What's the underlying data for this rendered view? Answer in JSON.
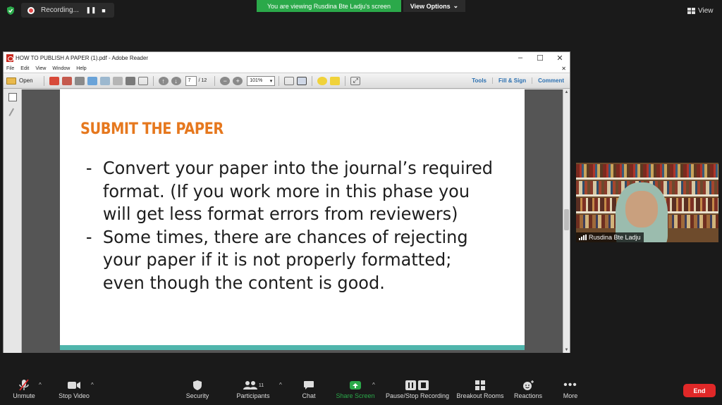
{
  "zoom_top": {
    "recording_label": "Recording...",
    "pause_glyph": "❚❚",
    "stop_glyph": "■",
    "viewing_banner": "You are viewing Rusdina Bte Ladju's screen",
    "view_options": "View Options",
    "view_label": "View"
  },
  "adobe": {
    "title": "HOW TO PUBLISH A PAPER (1).pdf - Adobe Reader",
    "menu": [
      "File",
      "Edit",
      "View",
      "Window",
      "Help"
    ],
    "toolbar": {
      "open_label": "Open",
      "page_current": "7",
      "page_total": "/ 12",
      "zoom": "101%",
      "tools_label": "Tools",
      "fill_sign_label": "Fill & Sign",
      "comment_label": "Comment"
    }
  },
  "slide": {
    "title": "SUBMIT THE PAPER",
    "bullets": [
      "Convert your paper into the journal’s required format. (If you work more in this phase you will get less format errors from reviewers)",
      "Some times, there are chances of rejecting your paper if it is not properly formatted; even though the content is good."
    ],
    "title_color": "#e6781e",
    "footer_color": "#4fb5ac"
  },
  "participant": {
    "name": "Rusdina Bte Ladju"
  },
  "zoom_bottom": {
    "unmute": "Unmute",
    "stop_video": "Stop Video",
    "security": "Security",
    "participants": "Participants",
    "participants_count": "11",
    "chat": "Chat",
    "share_screen": "Share Screen",
    "pause_stop_recording": "Pause/Stop Recording",
    "breakout_rooms": "Breakout Rooms",
    "reactions": "Reactions",
    "more": "More",
    "end": "End",
    "accent_green": "#2ba94a",
    "end_red": "#e02828"
  }
}
